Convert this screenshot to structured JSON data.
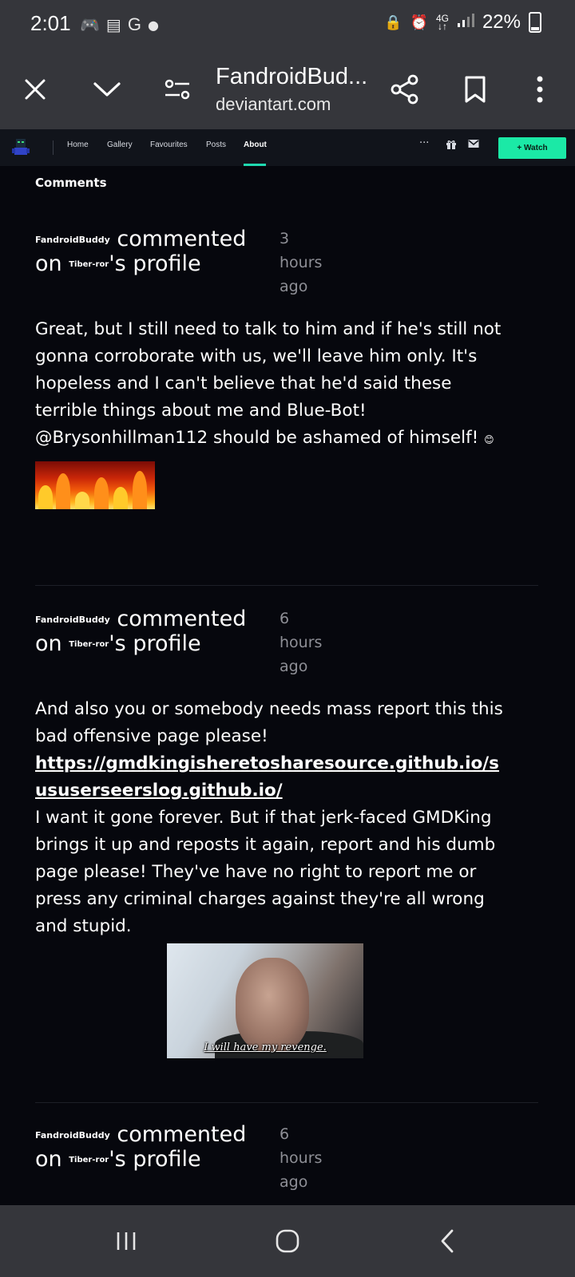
{
  "status_bar": {
    "time": "2:01",
    "network": "4G",
    "battery": "22%"
  },
  "browser": {
    "title": "FandroidBud...",
    "domain": "deviantart.com"
  },
  "site_nav": {
    "items": [
      "Home",
      "Gallery",
      "Favourites",
      "Posts",
      "About"
    ],
    "active": "About",
    "more": "···",
    "watch_label": "+ Watch"
  },
  "section_title": "Comments",
  "comments": [
    {
      "user": "FandroidBuddy",
      "action": "commented",
      "on": "on",
      "target": "Tiber-ror",
      "suffix": "'s profile",
      "time": "3 hours ago",
      "body": "Great, but I still need to talk to him and if he's still not gonna corroborate with us, we'll leave him only. It's hopeless and I can't believe that he'd said these terrible things about me and Blue-Bot! @Brysonhillman112 should be ashamed of himself!"
    },
    {
      "user": "FandroidBuddy",
      "action": "commented",
      "on": "on",
      "target": "Tiber-ror",
      "suffix": "'s profile",
      "time": "6 hours ago",
      "body_before": "And also you or somebody needs mass report this this bad offensive page please!",
      "link": "https://gmdkingisheretosharesource.github.io/sususerseerslog.github.io/",
      "body_after": "I want it gone forever. But if that jerk-faced GMDKing brings it up and reposts it again, report and his dumb page please! They've have no right to report me or press any criminal charges against they're all wrong and stupid.",
      "image_caption": "I will have my revenge."
    },
    {
      "user": "FandroidBuddy",
      "action": "commented",
      "on": "on",
      "target": "Tiber-ror",
      "suffix": "'s profile",
      "time": "6 hours ago"
    }
  ]
}
